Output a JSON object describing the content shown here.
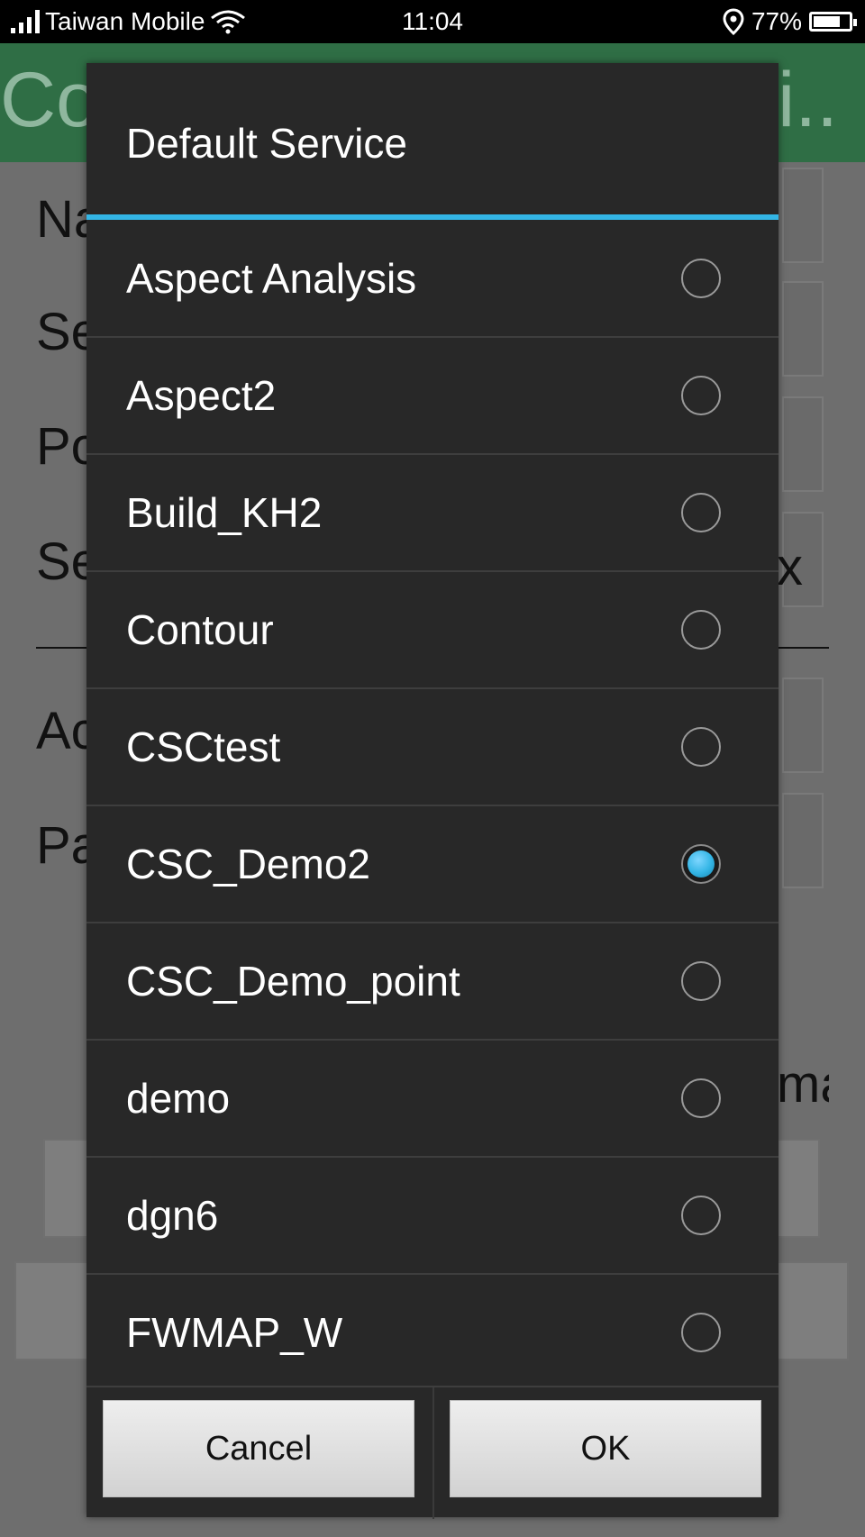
{
  "status_bar": {
    "carrier": "Taiwan Mobile",
    "time": "11:04",
    "battery": "77%",
    "battery_level": 0.77
  },
  "background": {
    "title_start": "Co",
    "title_end": "li..",
    "labels": [
      "Na",
      "Se",
      "Po",
      "Se",
      "Ac",
      "Pa"
    ],
    "side_texts": [
      "x",
      "ma"
    ]
  },
  "dialog": {
    "title": "Default Service",
    "items": [
      {
        "label": "Aspect Analysis",
        "checked": false
      },
      {
        "label": "Aspect2",
        "checked": false
      },
      {
        "label": "Build_KH2",
        "checked": false
      },
      {
        "label": "Contour",
        "checked": false
      },
      {
        "label": "CSCtest",
        "checked": false
      },
      {
        "label": "CSC_Demo2",
        "checked": true
      },
      {
        "label": "CSC_Demo_point",
        "checked": false
      },
      {
        "label": "demo",
        "checked": false
      },
      {
        "label": "dgn6",
        "checked": false
      },
      {
        "label": "FWMAP_W",
        "checked": false
      }
    ],
    "cancel_label": "Cancel",
    "ok_label": "OK"
  },
  "colors": {
    "accent": "#33b5e5",
    "dialog_bg": "#282828",
    "header_green": "#2f6e45"
  }
}
